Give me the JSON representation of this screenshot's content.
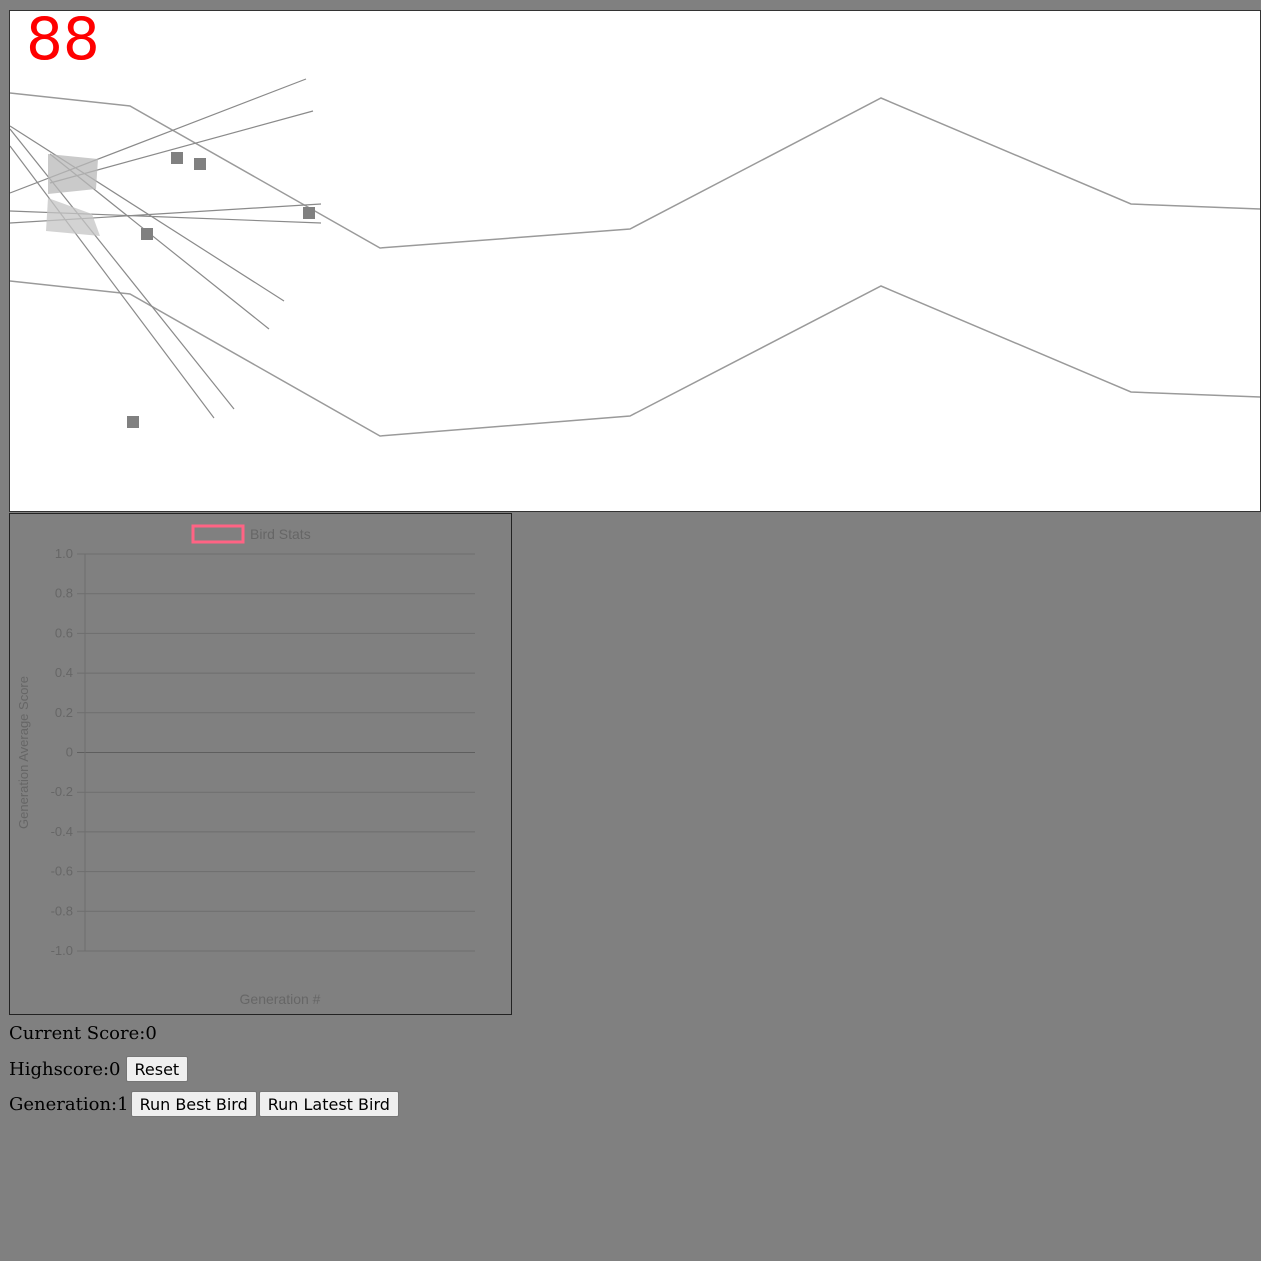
{
  "game": {
    "score_display": "88",
    "colors": {
      "track": "#999999",
      "sensor": "#808080",
      "bird": "#c0c0c0",
      "score": "#ff0000"
    }
  },
  "stats": {
    "current_score_label": "Current Score: ",
    "current_score": "0",
    "highscore_label": "Highscore: ",
    "highscore": "0",
    "reset_label": "Reset",
    "generation_label": "Generation: ",
    "generation": "1",
    "run_best_label": "Run Best Bird",
    "run_latest_label": "Run Latest Bird"
  },
  "chart_data": {
    "type": "line",
    "legend": [
      "Bird Stats"
    ],
    "legend_color": "#ff6384",
    "legend_placement": "top",
    "xlabel": "Generation #",
    "ylabel": "Generation Average Score",
    "ylim": [
      -1.0,
      1.0
    ],
    "yticks": [
      "1.0",
      "0.8",
      "0.6",
      "0.4",
      "0.2",
      "0",
      "-0.2",
      "-0.4",
      "-0.6",
      "-0.8",
      "-1.0"
    ],
    "categories": [],
    "series": [
      {
        "name": "Bird Stats",
        "values": []
      }
    ],
    "grid": true
  }
}
